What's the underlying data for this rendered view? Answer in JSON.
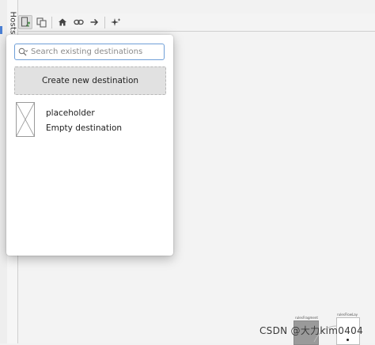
{
  "sidebar": {
    "tab_label": "Hosts"
  },
  "toolbar": {
    "buttons": [
      "new-destination-icon",
      "copy-icon",
      "home-icon",
      "link-icon",
      "arrow-right-icon",
      "sparkle-icon"
    ]
  },
  "popup": {
    "search_placeholder": "Search existing destinations",
    "create_label": "Create new destination",
    "destinations": [
      {
        "name": "placeholder",
        "subtitle": "Empty destination"
      }
    ]
  },
  "canvas": {
    "nodes": [
      {
        "label": "rulesFragment"
      },
      {
        "label": "rulesFlowLay"
      }
    ]
  },
  "watermark": "CSDN @大力kim0404",
  "colors": {
    "accent": "#4a7fd3",
    "search_border": "#6f9fd8",
    "create_bg": "#e1e1e1"
  }
}
